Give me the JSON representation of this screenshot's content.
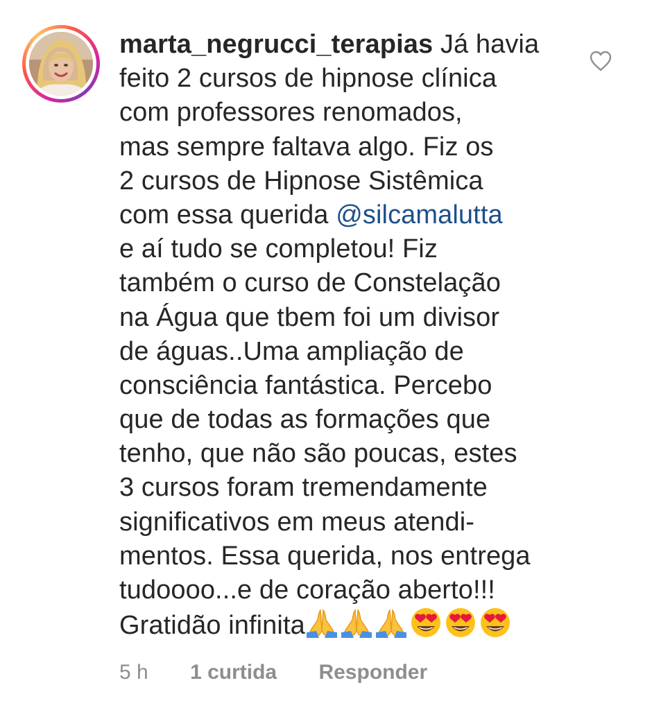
{
  "comment": {
    "username": "marta_negrucci_terapias",
    "lines": [
      " Já havia",
      "feito 2 cursos de hipnose clínica",
      "com professores renomados,",
      "mas sempre faltava algo. Fiz os",
      "2 cursos de Hipnose Sistêmica",
      "com essa querida ",
      "e aí tudo se  completou! Fiz",
      "também o curso de Constelação",
      "na Água que tbem foi um divisor",
      "de águas..Uma ampliação de",
      "consciência fantástica. Percebo",
      "que de todas as formações que",
      "tenho, que não são poucas, estes",
      "3 cursos foram tremendamente",
      "significativos em meus atendi-",
      "mentos. Essa querida, nos entrega",
      "tudoooo...e de coração aberto!!!",
      "Gratidão infinita"
    ],
    "mention": "@silcamalutta",
    "emojis": [
      "folded-hands",
      "folded-hands",
      "folded-hands",
      "heart-eyes-face",
      "heart-eyes-face",
      "heart-eyes-face"
    ]
  },
  "meta": {
    "time": "5 h",
    "likes": "1 curtida",
    "reply": "Responder"
  },
  "icons": {
    "like": "heart-outline-icon"
  },
  "colors": {
    "text": "#262626",
    "mention": "#1d4f8c",
    "meta": "#8e8e8e"
  }
}
